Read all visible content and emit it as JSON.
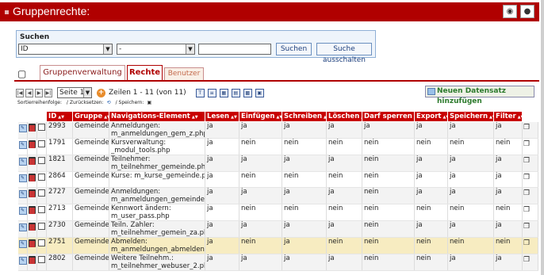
{
  "header": {
    "title": "Gruppenrechte:",
    "icons": [
      "binoculars-icon",
      "binoculars-dark-icon"
    ]
  },
  "search": {
    "label": "Suchen",
    "field_value": "ID",
    "operator_value": "-",
    "text_value": "",
    "search_label": "Suchen",
    "clear_label": "Suche ausschalten"
  },
  "tabs": {
    "group_admin": "Gruppenverwaltung",
    "rights": "Rechte",
    "users": "Benutzer"
  },
  "toolbar": {
    "page_value": "Seite 1",
    "rows_info": "Zeilen 1 - 11 (von 11)",
    "new_record": "Neuen Datensatz hinzufügen",
    "sort_label": "Sortierreihenfolge:",
    "reset_label": "/ Zurücksetzen:",
    "save_label": "/ Speichern:"
  },
  "table": {
    "columns": [
      "ID",
      "Gruppe",
      "Navigations-Element",
      "Lesen",
      "Einfügen",
      "Schreiben",
      "Löschen",
      "Darf sperren",
      "Export",
      "Speichern",
      "Filter"
    ],
    "rows": [
      {
        "id": "2993",
        "group": "Gemeinde",
        "nav1": "Anmeldungen:",
        "nav2": "m_anmeldungen_gem_z.php",
        "lesen": "ja",
        "einfuegen": "ja",
        "schreiben": "ja",
        "loeschen": "ja",
        "sperren": "ja",
        "export": "ja",
        "speichern": "ja",
        "filter": "ja"
      },
      {
        "id": "1791",
        "group": "Gemeinde",
        "nav1": "Kursverwaltung:",
        "nav2": "_modul_tools.php",
        "lesen": "ja",
        "einfuegen": "nein",
        "schreiben": "nein",
        "loeschen": "nein",
        "sperren": "nein",
        "export": "nein",
        "speichern": "nein",
        "filter": "nein"
      },
      {
        "id": "1821",
        "group": "Gemeinde",
        "nav1": "Teilnehmer:",
        "nav2": "m_teilnehmer_gemeinde.php",
        "lesen": "ja",
        "einfuegen": "ja",
        "schreiben": "ja",
        "loeschen": "ja",
        "sperren": "nein",
        "export": "ja",
        "speichern": "ja",
        "filter": "ja"
      },
      {
        "id": "2864",
        "group": "Gemeinde",
        "nav1": "Kurse: m_kurse_gemeinde.php",
        "nav2": "",
        "lesen": "ja",
        "einfuegen": "nein",
        "schreiben": "nein",
        "loeschen": "nein",
        "sperren": "nein",
        "export": "ja",
        "speichern": "ja",
        "filter": "ja"
      },
      {
        "id": "2727",
        "group": "Gemeinde",
        "nav1": "Anmeldungen:",
        "nav2": "m_anmeldungen_gemeinde.php",
        "lesen": "ja",
        "einfuegen": "ja",
        "schreiben": "ja",
        "loeschen": "ja",
        "sperren": "nein",
        "export": "ja",
        "speichern": "ja",
        "filter": "ja"
      },
      {
        "id": "2713",
        "group": "Gemeinde",
        "nav1": "Kennwort ändern:",
        "nav2": "m_user_pass.php",
        "lesen": "ja",
        "einfuegen": "nein",
        "schreiben": "nein",
        "loeschen": "nein",
        "sperren": "nein",
        "export": "nein",
        "speichern": "nein",
        "filter": "nein"
      },
      {
        "id": "2730",
        "group": "Gemeinde",
        "nav1": "Teiln. Zahler:",
        "nav2": "m_teilnehmer_gemein_za.php",
        "lesen": "ja",
        "einfuegen": "ja",
        "schreiben": "ja",
        "loeschen": "ja",
        "sperren": "nein",
        "export": "ja",
        "speichern": "ja",
        "filter": "ja"
      },
      {
        "id": "2751",
        "group": "Gemeinde",
        "nav1": "Abmelden:",
        "nav2": "m_anmeldungen_abmelden.php",
        "lesen": "ja",
        "einfuegen": "nein",
        "schreiben": "ja",
        "loeschen": "nein",
        "sperren": "nein",
        "export": "nein",
        "speichern": "nein",
        "filter": "nein"
      },
      {
        "id": "2802",
        "group": "Gemeinde",
        "nav1": "Weitere Teilnehm.:",
        "nav2": "m_teilnehmer_webuser_2.php",
        "lesen": "ja",
        "einfuegen": "ja",
        "schreiben": "ja",
        "loeschen": "ja",
        "sperren": "nein",
        "export": "nein",
        "speichern": "ja",
        "filter": "ja"
      }
    ]
  }
}
